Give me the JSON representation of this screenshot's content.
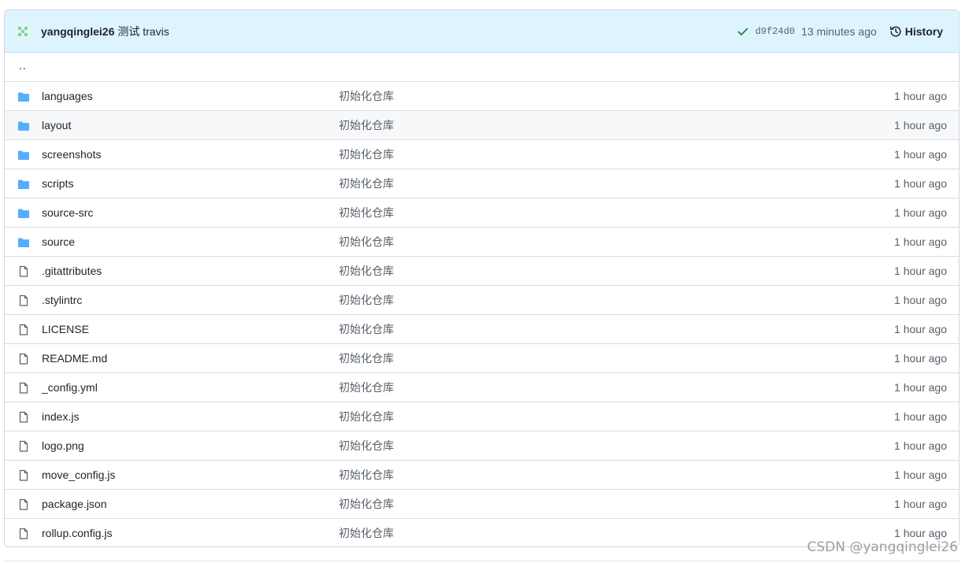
{
  "commit": {
    "author": "yangqinglei26",
    "message": "测试 travis",
    "sha": "d9f24d0",
    "time_ago": "13 minutes ago",
    "history_label": "History"
  },
  "up_dir": "..",
  "files": [
    {
      "name": "languages",
      "type": "folder",
      "message": "初始化仓库",
      "age": "1 hour ago"
    },
    {
      "name": "layout",
      "type": "folder",
      "message": "初始化仓库",
      "age": "1 hour ago"
    },
    {
      "name": "screenshots",
      "type": "folder",
      "message": "初始化仓库",
      "age": "1 hour ago"
    },
    {
      "name": "scripts",
      "type": "folder",
      "message": "初始化仓库",
      "age": "1 hour ago"
    },
    {
      "name": "source-src",
      "type": "folder",
      "message": "初始化仓库",
      "age": "1 hour ago"
    },
    {
      "name": "source",
      "type": "folder",
      "message": "初始化仓库",
      "age": "1 hour ago"
    },
    {
      "name": ".gitattributes",
      "type": "file",
      "message": "初始化仓库",
      "age": "1 hour ago"
    },
    {
      "name": ".stylintrc",
      "type": "file",
      "message": "初始化仓库",
      "age": "1 hour ago"
    },
    {
      "name": "LICENSE",
      "type": "file",
      "message": "初始化仓库",
      "age": "1 hour ago"
    },
    {
      "name": "README.md",
      "type": "file",
      "message": "初始化仓库",
      "age": "1 hour ago"
    },
    {
      "name": "_config.yml",
      "type": "file",
      "message": "初始化仓库",
      "age": "1 hour ago"
    },
    {
      "name": "index.js",
      "type": "file",
      "message": "初始化仓库",
      "age": "1 hour ago"
    },
    {
      "name": "logo.png",
      "type": "file",
      "message": "初始化仓库",
      "age": "1 hour ago"
    },
    {
      "name": "move_config.js",
      "type": "file",
      "message": "初始化仓库",
      "age": "1 hour ago"
    },
    {
      "name": "package.json",
      "type": "file",
      "message": "初始化仓库",
      "age": "1 hour ago"
    },
    {
      "name": "rollup.config.js",
      "type": "file",
      "message": "初始化仓库",
      "age": "1 hour ago"
    }
  ],
  "colors": {
    "folder": "#54aeff",
    "file": "#57606a",
    "check": "#1a7f37",
    "header_bg": "#ddf4ff"
  },
  "watermark": "CSDN @yangqinglei26"
}
